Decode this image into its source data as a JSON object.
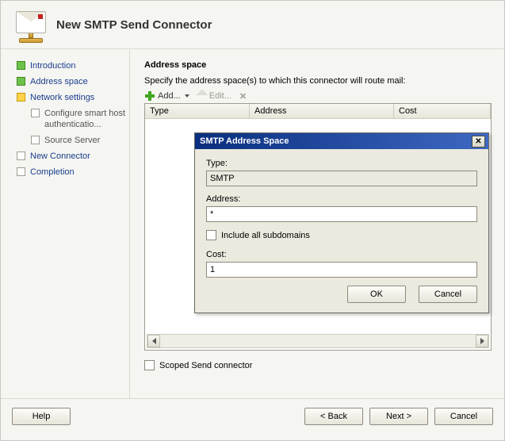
{
  "header": {
    "title": "New SMTP Send Connector"
  },
  "sidebar": {
    "items": [
      {
        "label": "Introduction",
        "state": "done"
      },
      {
        "label": "Address space",
        "state": "done"
      },
      {
        "label": "Network settings",
        "state": "current"
      },
      {
        "label": "Configure smart host authenticatio...",
        "state": "sub"
      },
      {
        "label": "Source Server",
        "state": "sub"
      },
      {
        "label": "New Connector",
        "state": "pending"
      },
      {
        "label": "Completion",
        "state": "pending"
      }
    ]
  },
  "main": {
    "heading": "Address space",
    "instruction": "Specify the address space(s) to which this connector will route mail:",
    "toolbar": {
      "add_label": "Add...",
      "edit_label": "Edit..."
    },
    "columns": {
      "type": "Type",
      "address": "Address",
      "cost": "Cost"
    },
    "scoped_label": "Scoped Send connector"
  },
  "footer": {
    "help": "Help",
    "back": "< Back",
    "next": "Next >",
    "cancel": "Cancel"
  },
  "modal": {
    "title": "SMTP Address Space",
    "type_label": "Type:",
    "type_value": "SMTP",
    "address_label": "Address:",
    "address_value": "*",
    "include_label": "Include all subdomains",
    "cost_label": "Cost:",
    "cost_value": "1",
    "ok": "OK",
    "cancel": "Cancel"
  }
}
